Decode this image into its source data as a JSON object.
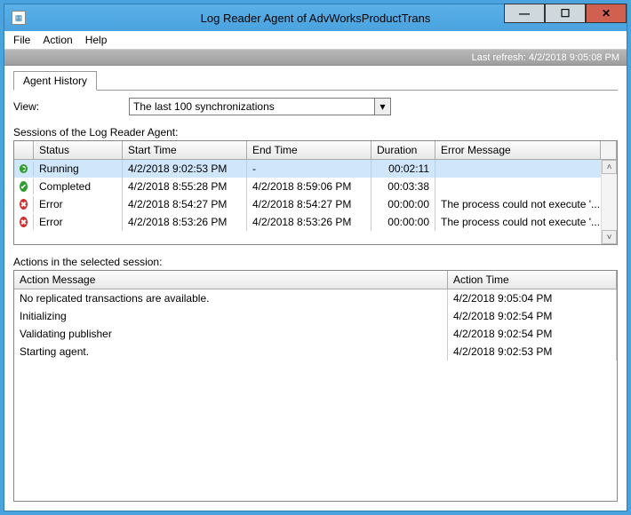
{
  "window": {
    "title": "Log Reader Agent of AdvWorksProductTrans"
  },
  "menu": {
    "file": "File",
    "action": "Action",
    "help": "Help"
  },
  "status": {
    "last_refresh": "Last refresh: 4/2/2018 9:05:08 PM"
  },
  "tabs": {
    "history": "Agent History"
  },
  "view": {
    "label": "View:",
    "selected": "The last 100 synchronizations"
  },
  "sessions": {
    "label": "Sessions of the Log Reader Agent:",
    "headers": {
      "status": "Status",
      "start": "Start Time",
      "end": "End Time",
      "duration": "Duration",
      "error": "Error Message"
    },
    "rows": [
      {
        "icon": "running",
        "status": "Running",
        "start": "4/2/2018 9:02:53 PM",
        "end": "-",
        "duration": "00:02:11",
        "error": ""
      },
      {
        "icon": "completed",
        "status": "Completed",
        "start": "4/2/2018 8:55:28 PM",
        "end": "4/2/2018 8:59:06 PM",
        "duration": "00:03:38",
        "error": ""
      },
      {
        "icon": "error",
        "status": "Error",
        "start": "4/2/2018 8:54:27 PM",
        "end": "4/2/2018 8:54:27 PM",
        "duration": "00:00:00",
        "error": "The process could not execute '..."
      },
      {
        "icon": "error",
        "status": "Error",
        "start": "4/2/2018 8:53:26 PM",
        "end": "4/2/2018 8:53:26 PM",
        "duration": "00:00:00",
        "error": "The process could not execute '..."
      }
    ]
  },
  "actions": {
    "label": "Actions in the selected session:",
    "headers": {
      "message": "Action Message",
      "time": "Action Time"
    },
    "rows": [
      {
        "msg": "No replicated transactions are available.",
        "time": "4/2/2018 9:05:04 PM"
      },
      {
        "msg": "Initializing",
        "time": "4/2/2018 9:02:54 PM"
      },
      {
        "msg": "Validating publisher",
        "time": "4/2/2018 9:02:54 PM"
      },
      {
        "msg": "Starting agent.",
        "time": "4/2/2018 9:02:53 PM"
      }
    ]
  }
}
